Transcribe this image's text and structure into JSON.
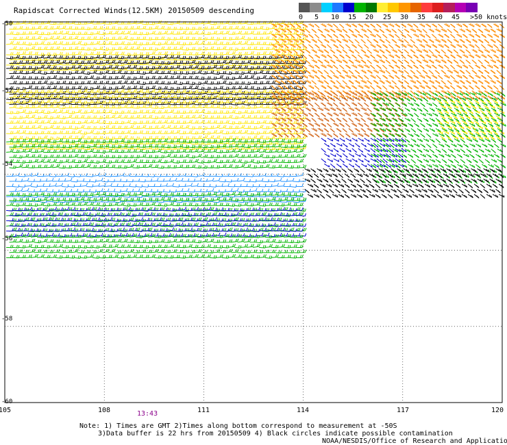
{
  "header": {
    "title": "Rapidscat Corrected Winds(12.5KM) 20150509 descending"
  },
  "colorbar": {
    "labels": [
      "0",
      "5",
      "10",
      "15",
      "20",
      "25",
      "30",
      "35",
      "40",
      "45",
      ">50 knots"
    ],
    "colors": [
      "#555555",
      "#8c8c8c",
      "#00d0ff",
      "#1e78ff",
      "#0000cd",
      "#00b400",
      "#007800",
      "#ffee33",
      "#ffc800",
      "#ff9600",
      "#e66400",
      "#ff3c3c",
      "#dc1e1e",
      "#b41e5a",
      "#b400b4",
      "#7800b4"
    ]
  },
  "time_label": "13:43",
  "notes": {
    "line1": "Note: 1) Times are GMT 2)Times along bottom correspond to measurement at -50S",
    "line2": "3)Data buffer is 22 hrs from 20150509 4) Black circles indicate possible contamination",
    "line3": "NOAA/NESDIS/Office of Research and Applications"
  },
  "chart_data": {
    "type": "scatter",
    "title": "Rapidscat Corrected Winds(12.5KM) 20150509 descending",
    "xlim": [
      105,
      120
    ],
    "ylim": [
      -60,
      -50
    ],
    "x_ticks": [
      "105",
      "108",
      "111",
      "114",
      "117",
      "120"
    ],
    "y_ticks": [
      "-50",
      "-52",
      "-54",
      "-56",
      "-58",
      "-60"
    ],
    "grid": true,
    "wind_speed_bins_knots": [
      0,
      5,
      10,
      15,
      20,
      25,
      30,
      35,
      40,
      45,
      50
    ],
    "colors_by_speed": {
      "black": "#000000",
      "blue": "#0000cd",
      "cyan": "#1e90ff",
      "green": "#00b400",
      "darkgreen": "#007800",
      "yellow": "#ffe600",
      "orange": "#ff8c00",
      "darkorange": "#d2691e"
    },
    "wind_fields": [
      {
        "name": "",
        "lon": [
          105.0,
          114.0
        ],
        "lat": [
          -51.3,
          -50.0
        ],
        "direction": "from west",
        "speed_knots": 24,
        "color": "yellow"
      },
      {
        "name": "",
        "lon": [
          105.0,
          114.0
        ],
        "lat": [
          -52.2,
          -50.9
        ],
        "direction": "from west",
        "speed_knots": 20,
        "color": "black"
      },
      {
        "name": "",
        "lon": [
          105.0,
          114.0
        ],
        "lat": [
          -53.4,
          -51.8
        ],
        "direction": "from west",
        "speed_knots": 23,
        "color": "yellow"
      },
      {
        "name": "",
        "lon": [
          105.0,
          114.0
        ],
        "lat": [
          -53.9,
          -53.1
        ],
        "direction": "from west",
        "speed_knots": 17,
        "color": "green"
      },
      {
        "name": "",
        "lon": [
          105.0,
          114.0
        ],
        "lat": [
          -54.8,
          -54.0
        ],
        "direction": "from west",
        "speed_knots": 10,
        "color": "cyan"
      },
      {
        "name": "",
        "lon": [
          105.0,
          114.0
        ],
        "lat": [
          -55.6,
          -54.5
        ],
        "direction": "from west",
        "speed_knots": 16,
        "color": "green"
      },
      {
        "name": "",
        "lon": [
          105.0,
          114.0
        ],
        "lat": [
          -55.7,
          -54.9
        ],
        "direction": "from west",
        "speed_knots": 13,
        "color": "blue"
      },
      {
        "name": "",
        "lon": [
          105.0,
          114.0
        ],
        "lat": [
          -56.3,
          -55.6
        ],
        "direction": "from west",
        "speed_knots": 18,
        "color": "green"
      },
      {
        "name": "",
        "lon": [
          113.0,
          120.0
        ],
        "lat": [
          -52.0,
          -50.0
        ],
        "direction": "from north-west",
        "speed_knots": 28,
        "color": "orange"
      },
      {
        "name": "",
        "lon": [
          113.0,
          117.0
        ],
        "lat": [
          -53.0,
          -51.8
        ],
        "direction": "from north-west",
        "speed_knots": 30,
        "color": "darkorange"
      },
      {
        "name": "",
        "lon": [
          116.0,
          120.0
        ],
        "lat": [
          -54.2,
          -51.8
        ],
        "direction": "from north-west",
        "speed_knots": 19,
        "color": "green"
      },
      {
        "name": "",
        "lon": [
          118.0,
          120.0
        ],
        "lat": [
          -53.0,
          -52.0
        ],
        "direction": "from north-west",
        "speed_knots": 24,
        "color": "yellow"
      },
      {
        "name": "",
        "lon": [
          114.5,
          117.0
        ],
        "lat": [
          -53.8,
          -53.0
        ],
        "direction": "from north-west",
        "speed_knots": 14,
        "color": "blue"
      },
      {
        "name": "",
        "lon": [
          114.0,
          120.0
        ],
        "lat": [
          -54.6,
          -53.8
        ],
        "direction": "from north-west",
        "speed_knots": 20,
        "color": "black"
      }
    ]
  }
}
